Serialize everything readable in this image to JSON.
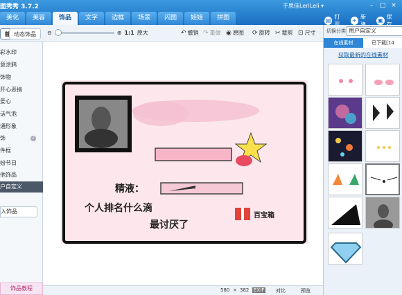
{
  "app": {
    "title": "图秀秀 3.7.2"
  },
  "tabs": [
    {
      "label": "美化",
      "active": false
    },
    {
      "label": "美容",
      "active": false
    },
    {
      "label": "饰品",
      "active": true
    },
    {
      "label": "文字",
      "active": false
    },
    {
      "label": "边框",
      "active": false
    },
    {
      "label": "场景",
      "active": false
    },
    {
      "label": "闪图",
      "active": false
    },
    {
      "label": "娃娃",
      "active": false
    },
    {
      "label": "拼图",
      "active": false
    }
  ],
  "user": {
    "name": "于思佳LeriLeli ▾"
  },
  "window_controls": [
    "–",
    "□",
    "×"
  ],
  "actions": {
    "open": "打开",
    "new": "新建",
    "save": "保存..."
  },
  "toolbar": {
    "subtab_static": "静态饰品",
    "subtab_dynamic": "动态饰品",
    "zoom_ratio": "1:1",
    "original_size": "原大",
    "undo": "撤销",
    "redo": "重做",
    "original": "原图",
    "rotate": "旋转",
    "crop": "裁剪",
    "size": "尺寸",
    "zoom_level": 0
  },
  "sidebar": {
    "items": [
      {
        "label": "彩水印",
        "selected": false
      },
      {
        "label": "意涂鸦",
        "selected": false
      },
      {
        "label": "饰物",
        "selected": false
      },
      {
        "label": "开心恶搞",
        "selected": false
      },
      {
        "label": "爱心",
        "selected": false
      },
      {
        "label": "话气泡",
        "selected": false
      },
      {
        "label": "通形象",
        "selected": false
      },
      {
        "label": "饰",
        "selected": false,
        "badge": "✓"
      },
      {
        "label": "件框",
        "selected": false
      },
      {
        "label": "纷节日",
        "selected": false
      },
      {
        "label": "他饰品",
        "selected": false
      },
      {
        "label": "户自定义",
        "selected": true
      }
    ],
    "import_label": "入饰品",
    "tutorial_label": "饰品教程"
  },
  "canvas": {
    "card_lines": [
      "精液：",
      "个人排名什么滴",
      "最讨厌了"
    ],
    "gift_label": "百宝箱"
  },
  "statusbar": {
    "width": "580",
    "times": "×",
    "height": "382",
    "exif": "EXIF",
    "compare": "对比",
    "preview": "预览"
  },
  "rightpanel": {
    "category_label": "切换分类",
    "category_value": "用户自定义",
    "tabs": [
      {
        "label": "在线素材",
        "active": true
      },
      {
        "label": "已下载[14",
        "active": false
      }
    ],
    "get_new": "获取最新的在线素材",
    "thumbnails": [
      "pink-dots",
      "pink-tongue",
      "purple-stars",
      "black-bow",
      "sparkle-lights",
      "star-outline-dots",
      "cat-ears",
      "cat-whiskers",
      "black-triangle",
      "girl-photo",
      "diamond-gem"
    ]
  },
  "colors": {
    "accent": "#2f86d6",
    "card_pink": "#fde7ec",
    "bar_pink": "#f6b6c8"
  }
}
